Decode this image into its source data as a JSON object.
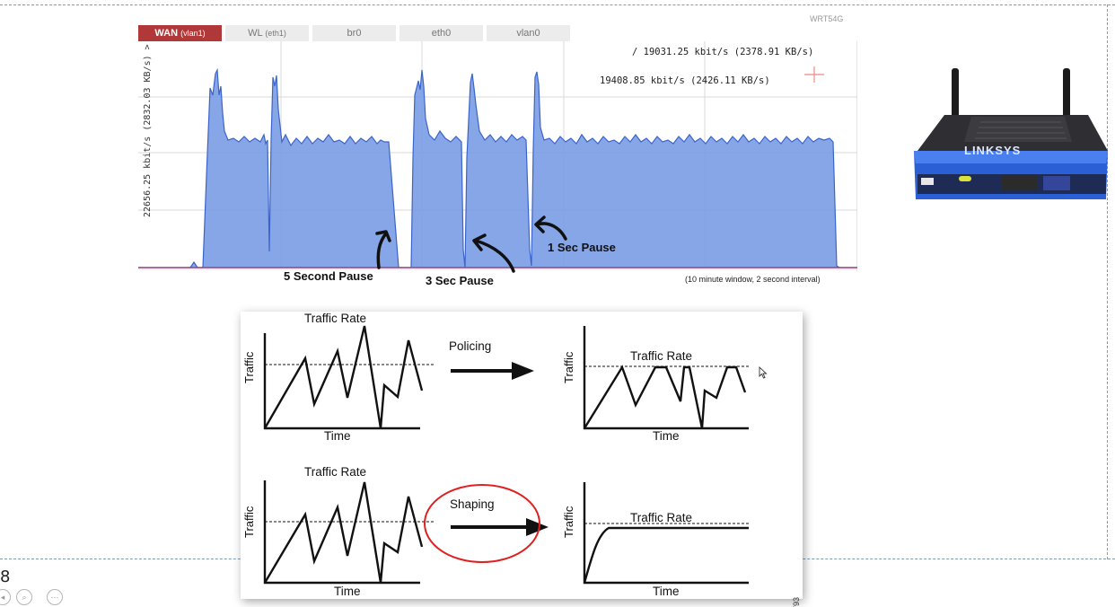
{
  "router_model": "WRT54G",
  "tabs": [
    {
      "label": "WAN",
      "sub": "(vlan1)",
      "active": true
    },
    {
      "label": "WL",
      "sub": "(eth1)",
      "active": false
    },
    {
      "label": "br0",
      "sub": "",
      "active": false
    },
    {
      "label": "eth0",
      "sub": "",
      "active": false
    },
    {
      "label": "vlan0",
      "sub": "",
      "active": false
    }
  ],
  "rates": {
    "line1": "/ 19031.25 kbit/s (2378.91 KB/s)",
    "line2": "19408.85 kbit/s (2426.11 KB/s)",
    "ylabel": "22656.25 kbit/s (2832.03 KB/s) >"
  },
  "annotations": {
    "five_sec": "5 Second Pause",
    "three_sec": "3 Sec Pause",
    "one_sec": "1 Sec Pause"
  },
  "window_note": "(10 minute window, 2 second interval)",
  "diagram": {
    "traffic_rate": "Traffic Rate",
    "traffic": "Traffic",
    "time": "Time",
    "policing": "Policing",
    "shaping": "Shaping",
    "figure_id": "144793"
  },
  "slide_number": "8",
  "colors": {
    "fill": "#7c9ee6",
    "stroke": "#3b64c8",
    "tab_active": "#b03838",
    "circle": "#e02020"
  }
}
